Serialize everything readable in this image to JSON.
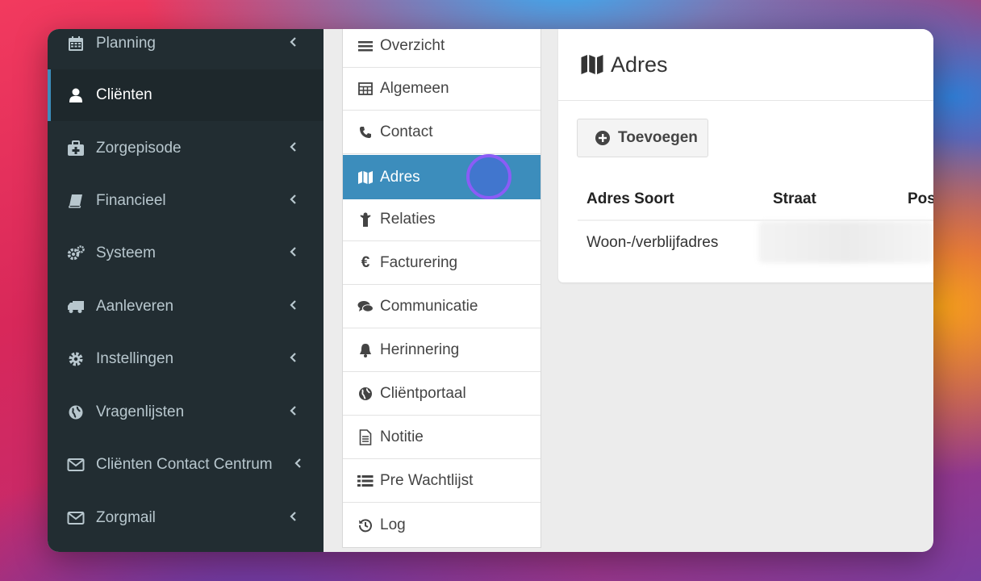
{
  "sidebar": {
    "items": [
      {
        "label": "Planning",
        "icon": "calendar-icon",
        "has_chevron": true,
        "active": false
      },
      {
        "label": "Cliënten",
        "icon": "user-icon",
        "has_chevron": false,
        "active": true
      },
      {
        "label": "Zorgepisode",
        "icon": "medkit-icon",
        "has_chevron": true,
        "active": false
      },
      {
        "label": "Financieel",
        "icon": "book-icon",
        "has_chevron": true,
        "active": false
      },
      {
        "label": "Systeem",
        "icon": "cogs-icon",
        "has_chevron": true,
        "active": false
      },
      {
        "label": "Aanleveren",
        "icon": "truck-icon",
        "has_chevron": true,
        "active": false
      },
      {
        "label": "Instellingen",
        "icon": "gear-icon",
        "has_chevron": true,
        "active": false
      },
      {
        "label": "Vragenlijsten",
        "icon": "globe-icon",
        "has_chevron": true,
        "active": false
      },
      {
        "label": "Cliënten Contact Centrum",
        "icon": "envelope-icon",
        "has_chevron": true,
        "active": false
      },
      {
        "label": "Zorgmail",
        "icon": "envelope-icon",
        "has_chevron": true,
        "active": false
      }
    ]
  },
  "subnav": {
    "items": [
      {
        "label": "Overzicht",
        "icon": "bars-icon",
        "active": false
      },
      {
        "label": "Algemeen",
        "icon": "table-icon",
        "active": false
      },
      {
        "label": "Contact",
        "icon": "phone-icon",
        "active": false
      },
      {
        "label": "Adres",
        "icon": "map-icon",
        "active": true
      },
      {
        "label": "Relaties",
        "icon": "child-icon",
        "active": false
      },
      {
        "label": "Facturering",
        "icon": "euro-icon",
        "active": false
      },
      {
        "label": "Communicatie",
        "icon": "comments-icon",
        "active": false
      },
      {
        "label": "Herinnering",
        "icon": "bell-icon",
        "active": false
      },
      {
        "label": "Cliëntportaal",
        "icon": "globe-icon",
        "active": false
      },
      {
        "label": "Notitie",
        "icon": "file-text-icon",
        "active": false
      },
      {
        "label": "Pre Wachtlijst",
        "icon": "list-icon",
        "active": false
      },
      {
        "label": "Log",
        "icon": "history-icon",
        "active": false
      }
    ]
  },
  "main": {
    "title": "Adres",
    "title_icon": "map-icon",
    "add_button": "Toevoegen",
    "add_icon": "plus-circle-icon",
    "columns": [
      "Adres Soort",
      "Straat",
      "Pos"
    ],
    "rows": [
      [
        "Woon-/verblijfadres"
      ]
    ]
  },
  "colors": {
    "sidebar_bg": "#222d32",
    "sidebar_active_bg": "#1e282c",
    "accent": "#3c8dbc",
    "cursor_ring": "#8b5cf6"
  }
}
